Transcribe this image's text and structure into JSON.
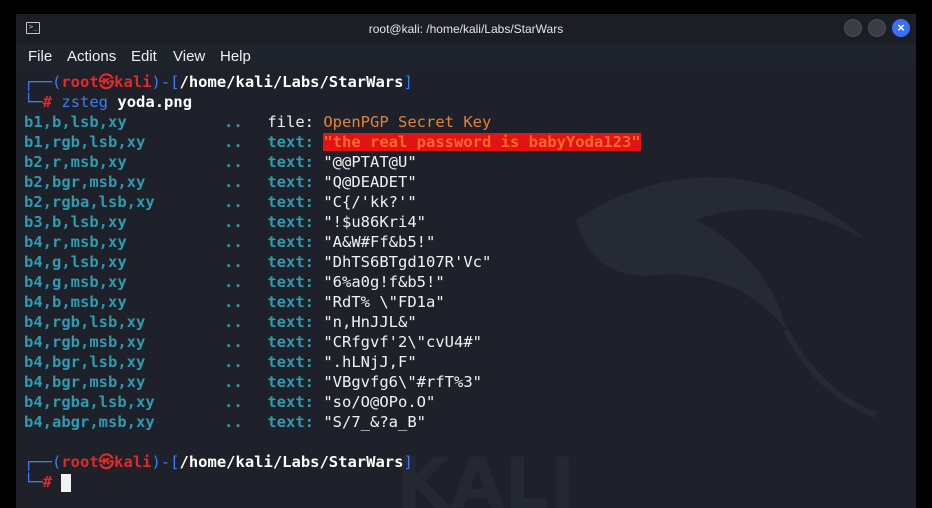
{
  "window": {
    "title": "root@kali: /home/kali/Labs/StarWars",
    "terminal_icon_glyph": ">_"
  },
  "menu": [
    "File",
    "Actions",
    "Edit",
    "View",
    "Help"
  ],
  "prompt": {
    "open": "┌──(",
    "user": "root",
    "skull": "㉿",
    "host": "kali",
    "mid": ")-[",
    "path": "/home/kali/Labs/StarWars",
    "close": "]",
    "second_prefix": "└─",
    "hash": "#"
  },
  "command": {
    "name": "zsteg",
    "arg": "yoda.png"
  },
  "output": [
    {
      "mode": "b1,b,lsb,xy",
      "kind": "file:",
      "value": "OpenPGP Secret Key",
      "style": "orange"
    },
    {
      "mode": "b1,rgb,lsb,xy",
      "kind": "text:",
      "value": "\"the real password is babyYoda123\"",
      "style": "highlight"
    },
    {
      "mode": "b2,r,msb,xy",
      "kind": "text:",
      "value": "\"@@PTAT@U\"",
      "style": "white"
    },
    {
      "mode": "b2,bgr,msb,xy",
      "kind": "text:",
      "value": "\"Q@DEADET\"",
      "style": "white"
    },
    {
      "mode": "b2,rgba,lsb,xy",
      "kind": "text:",
      "value": "\"C{/'kk?'\"",
      "style": "white"
    },
    {
      "mode": "b3,b,lsb,xy",
      "kind": "text:",
      "value": "\"!$u86Kri4\"",
      "style": "white"
    },
    {
      "mode": "b4,r,msb,xy",
      "kind": "text:",
      "value": "\"A&W#Ff&b5!\"",
      "style": "white"
    },
    {
      "mode": "b4,g,lsb,xy",
      "kind": "text:",
      "value": "\"DhTS6BTgd107R'Vc\"",
      "style": "white"
    },
    {
      "mode": "b4,g,msb,xy",
      "kind": "text:",
      "value": "\"6%a0g!f&b5!\"",
      "style": "white"
    },
    {
      "mode": "b4,b,msb,xy",
      "kind": "text:",
      "value": "\"RdT% \\\"FD1a\"",
      "style": "white"
    },
    {
      "mode": "b4,rgb,lsb,xy",
      "kind": "text:",
      "value": "\"n,HnJJL&\"",
      "style": "white"
    },
    {
      "mode": "b4,rgb,msb,xy",
      "kind": "text:",
      "value": "\"CRfgvf'2\\\"cvU4#\"",
      "style": "white"
    },
    {
      "mode": "b4,bgr,lsb,xy",
      "kind": "text:",
      "value": "\".hLNjJ,F\"",
      "style": "white"
    },
    {
      "mode": "b4,bgr,msb,xy",
      "kind": "text:",
      "value": "\"VBgvfg6\\\"#rfT%3\"",
      "style": "white"
    },
    {
      "mode": "b4,rgba,lsb,xy",
      "kind": "text:",
      "value": "\"so/O@OPo.O\"",
      "style": "white"
    },
    {
      "mode": "b4,abgr,msb,xy",
      "kind": "text:",
      "value": "\"S/7_&?a_B\"",
      "style": "white"
    }
  ],
  "dots": "..",
  "watermark": "KALI",
  "colors": {
    "prompt_bracket": "#3d7df0",
    "prompt_user": "#e02a2a",
    "mode_text": "#2f9bb0",
    "file_value": "#e0843a",
    "highlight_bg": "#e01414",
    "close_button": "#3b6ff5"
  }
}
